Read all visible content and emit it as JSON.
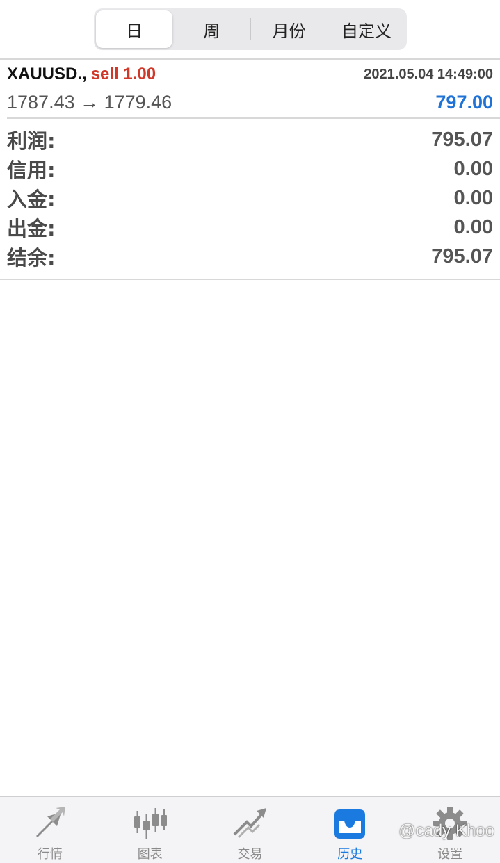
{
  "period_tabs": [
    {
      "label": "日",
      "active": true
    },
    {
      "label": "周",
      "active": false
    },
    {
      "label": "月份",
      "active": false
    },
    {
      "label": "自定义",
      "active": false
    }
  ],
  "deal": {
    "symbol": "XAUUSD.,",
    "side": "sell 1.00",
    "datetime": "2021.05.04 14:49:00",
    "prices": "1787.43 → 1779.46",
    "profit": "797.00"
  },
  "summary": [
    {
      "label": "利润:",
      "value": "795.07"
    },
    {
      "label": "信用:",
      "value": "0.00"
    },
    {
      "label": "入金:",
      "value": "0.00"
    },
    {
      "label": "出金:",
      "value": "0.00"
    },
    {
      "label": "结余:",
      "value": "795.07"
    }
  ],
  "tabbar": [
    {
      "label": "行情",
      "icon": "quotes-icon",
      "active": false
    },
    {
      "label": "图表",
      "icon": "chart-icon",
      "active": false
    },
    {
      "label": "交易",
      "icon": "trade-icon",
      "active": false
    },
    {
      "label": "历史",
      "icon": "history-icon",
      "active": true
    },
    {
      "label": "设置",
      "icon": "settings-icon",
      "active": false
    }
  ],
  "watermark": "@cady Khoo",
  "colors": {
    "accent": "#1a7ae0",
    "sell": "#d0382a",
    "profit": "#2073d6",
    "icon_gray": "#8c8c8c"
  }
}
